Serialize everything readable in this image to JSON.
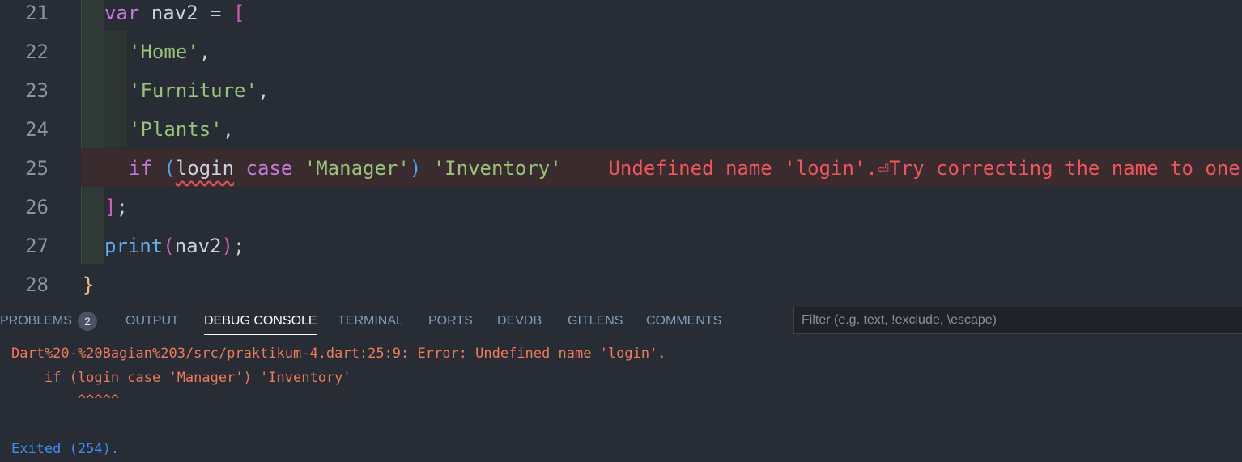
{
  "editor": {
    "lines": [
      {
        "num": "21",
        "tokens": [
          {
            "t": "var",
            "c": "kw"
          },
          {
            "t": " nav2 = ",
            "c": "plain"
          },
          {
            "t": "[",
            "c": "br1"
          }
        ]
      },
      {
        "num": "22",
        "tokens": [
          {
            "t": "'Home'",
            "c": "str"
          },
          {
            "t": ",",
            "c": "plain"
          }
        ]
      },
      {
        "num": "23",
        "tokens": [
          {
            "t": "'Furniture'",
            "c": "str"
          },
          {
            "t": ",",
            "c": "plain"
          }
        ]
      },
      {
        "num": "24",
        "tokens": [
          {
            "t": "'Plants'",
            "c": "str"
          },
          {
            "t": ",",
            "c": "plain"
          }
        ]
      },
      {
        "num": "25",
        "tokens": [
          {
            "t": "if",
            "c": "kw"
          },
          {
            "t": " ",
            "c": "plain"
          },
          {
            "t": "(",
            "c": "br2"
          },
          {
            "t": "login",
            "c": "plain squiggle"
          },
          {
            "t": " case ",
            "c": "kw"
          },
          {
            "t": "'Manager'",
            "c": "str"
          },
          {
            "t": ")",
            "c": "br2"
          },
          {
            "t": " ",
            "c": "plain"
          },
          {
            "t": "'Inventory'",
            "c": "str"
          },
          {
            "t": "    Undefined name 'login'.⏎Try correcting the name to one",
            "c": "err"
          }
        ]
      },
      {
        "num": "26",
        "tokens": [
          {
            "t": "]",
            "c": "br1"
          },
          {
            "t": ";",
            "c": "plain"
          }
        ]
      },
      {
        "num": "27",
        "tokens": [
          {
            "t": "print",
            "c": "fn"
          },
          {
            "t": "(",
            "c": "br1"
          },
          {
            "t": "nav2",
            "c": "plain"
          },
          {
            "t": ")",
            "c": "br1"
          },
          {
            "t": ";",
            "c": "plain"
          }
        ]
      },
      {
        "num": "28",
        "tokens": [
          {
            "t": "}",
            "c": "brace"
          }
        ]
      }
    ]
  },
  "panel": {
    "tabs": [
      {
        "label": "PROBLEMS",
        "name": "tab-problems"
      },
      {
        "label": "OUTPUT",
        "name": "tab-output"
      },
      {
        "label": "DEBUG CONSOLE",
        "name": "tab-debug-console"
      },
      {
        "label": "TERMINAL",
        "name": "tab-terminal"
      },
      {
        "label": "PORTS",
        "name": "tab-ports"
      },
      {
        "label": "DEVDB",
        "name": "tab-devdb"
      },
      {
        "label": "GITLENS",
        "name": "tab-gitlens"
      },
      {
        "label": "COMMENTS",
        "name": "tab-comments"
      }
    ],
    "problems_count": "2",
    "filter_placeholder": "Filter (e.g. text, !exclude, \\escape)"
  },
  "console": {
    "lines": [
      "Dart%20-%20Bagian%203/src/praktikum-4.dart:25:9: Error: Undefined name 'login'.",
      "    if (login case 'Manager') 'Inventory'",
      "        ^^^^^",
      "Exited (254)."
    ]
  }
}
